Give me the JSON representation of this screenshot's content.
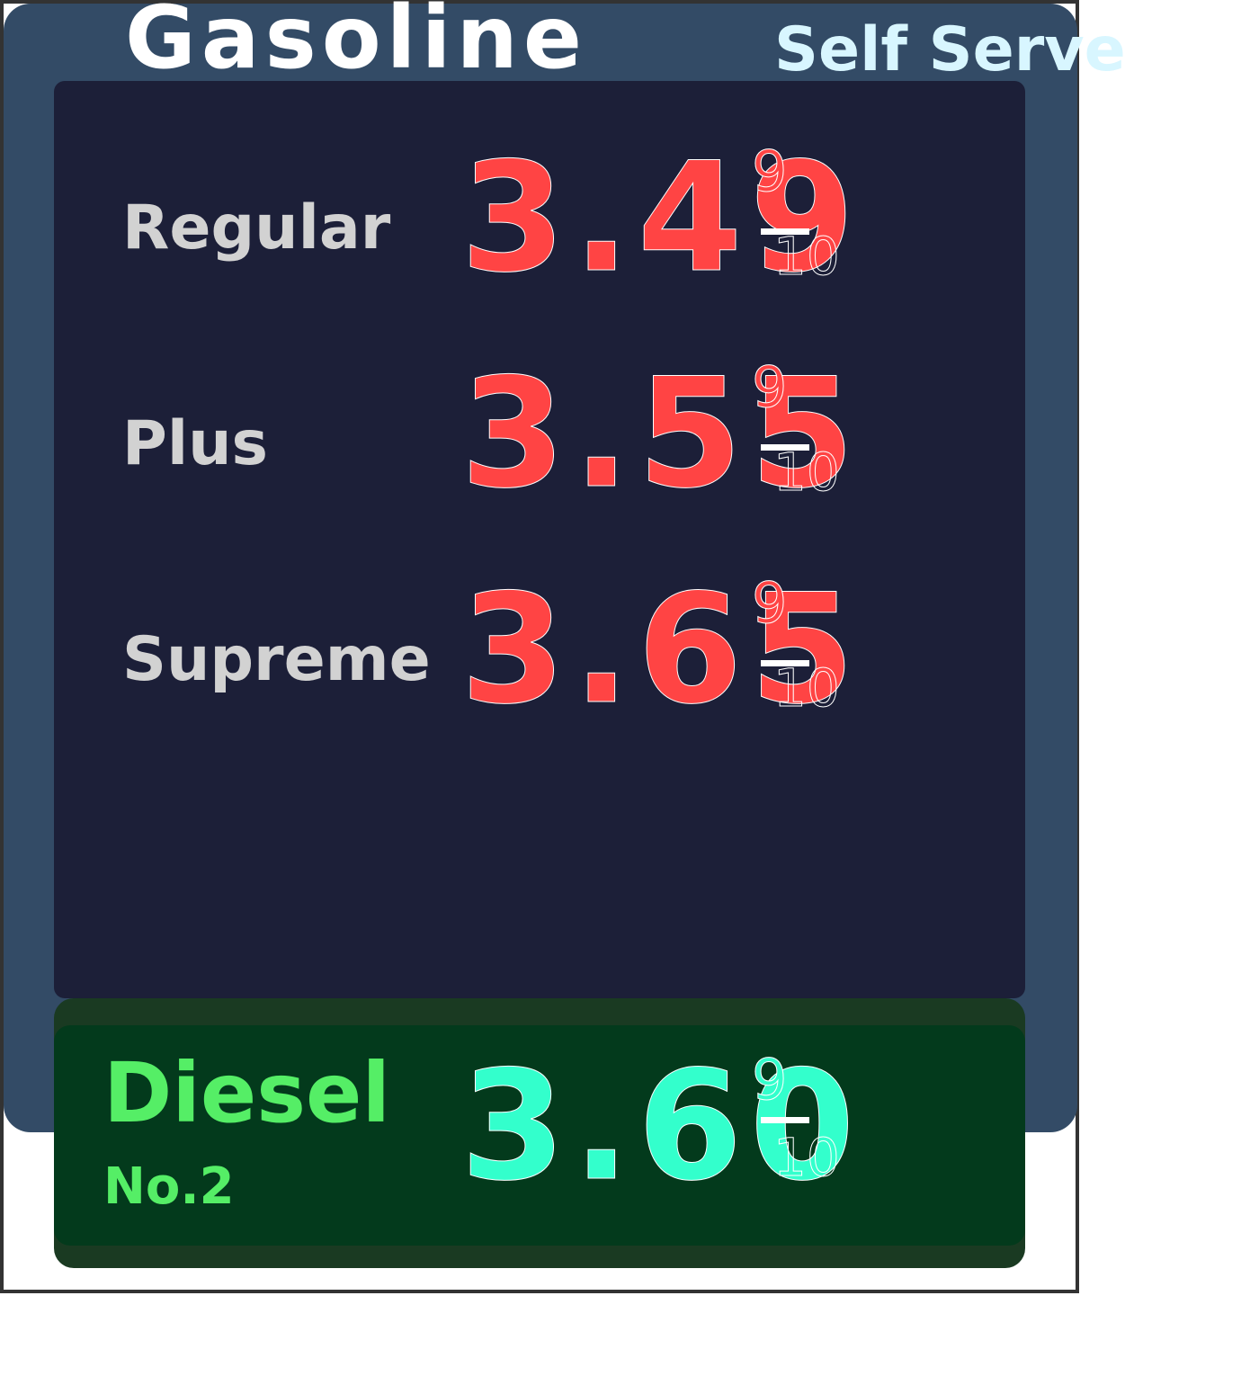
{
  "header": {
    "title": "Gasoline",
    "subtitle": "Self Serve"
  },
  "grades": [
    {
      "label": "Regular",
      "price": "3.49",
      "frac_num": "9",
      "frac_den": "10"
    },
    {
      "label": "Plus",
      "price": "3.55",
      "frac_num": "9",
      "frac_den": "10"
    },
    {
      "label": "Supreme",
      "price": "3.65",
      "frac_num": "9",
      "frac_den": "10"
    }
  ],
  "diesel": {
    "label": "Diesel",
    "sublabel": "No.2",
    "price": "3.60",
    "frac_num": "9",
    "frac_den": "10"
  },
  "colors": {
    "frame": "#333333",
    "gas_panel": "#334b66",
    "board": "#1c1f38",
    "title": "#ffffff",
    "subtitle": "#d8f6ff",
    "grade_label": "#d2d2d2",
    "gas_price": "#ff4444",
    "diesel_outer": "#1a3a22",
    "diesel_inner": "#033a1c",
    "diesel_label": "#55ee66",
    "diesel_price": "#33ffcc"
  }
}
